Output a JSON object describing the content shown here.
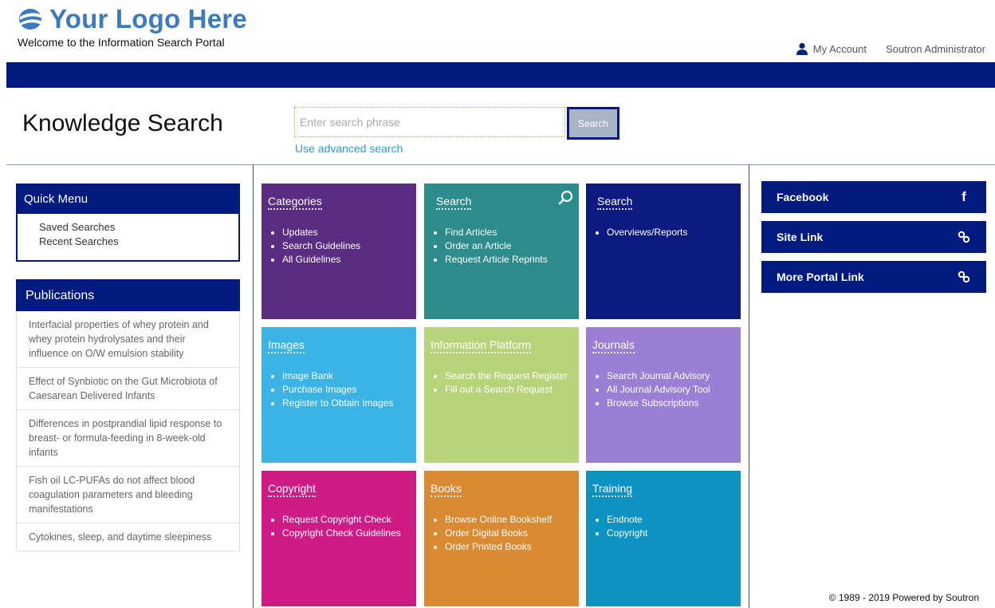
{
  "header": {
    "logo_text": "Your Logo Here",
    "welcome": "Welcome to the Information Search Portal",
    "my_account": "My Account",
    "user_name": "Soutron Administrator",
    "bar_color": "#001a80"
  },
  "search": {
    "title": "Knowledge Search",
    "placeholder": "Enter search phrase",
    "button": "Search",
    "advanced_link": "Use advanced search"
  },
  "quick_menu": {
    "title": "Quick Menu",
    "items": [
      "Saved Searches",
      "Recent Searches"
    ]
  },
  "publications": {
    "title": "Publications",
    "items": [
      "Interfacial properties of whey protein and whey protein hydrolysates and their influence on O/W emulsion stability",
      "Effect of Synbiotic on the Gut Microbiota of Caesarean Delivered Infants",
      "Differences in postprandial lipid response to breast- or formula-feeding in 8-week-old infants",
      "Fish oil LC-PUFAs do not affect blood coagulation parameters and bleeding manifestations",
      "Cytokines, sleep, and daytime sleepiness"
    ]
  },
  "tiles": [
    {
      "title": "Categories",
      "color": "#5a2d82",
      "icon": "",
      "items": [
        "Updates",
        "Search Guidelines",
        "All Guidelines"
      ]
    },
    {
      "title": "Search",
      "color": "#2e8b8b",
      "icon": "search-icon",
      "items": [
        "Find Articles",
        "Order an Article",
        "Request Article Reprints"
      ]
    },
    {
      "title": "Search",
      "color": "#0d1a82",
      "icon": "",
      "items": [
        "Overviews/Reports"
      ]
    },
    {
      "title": "Images",
      "color": "#3bb3e4",
      "icon": "",
      "items": [
        "Image Bank",
        "Purchase Images",
        "Register to Obtain Images"
      ]
    },
    {
      "title": "Information Platform",
      "color": "#b8d47a",
      "icon": "",
      "items": [
        "Search the Request Register",
        "Fill out a Search Request"
      ]
    },
    {
      "title": "Journals",
      "color": "#9b7fd4",
      "icon": "",
      "items": [
        "Search Journal Advisory",
        "All Journal Advisory Tool",
        "Browse Subscriptions"
      ]
    },
    {
      "title": "Copyright",
      "color": "#cf1b86",
      "icon": "",
      "items": [
        "Request Copyright Check",
        "Copyright Check Guidelines"
      ]
    },
    {
      "title": "Books",
      "color": "#d98a33",
      "icon": "",
      "items": [
        "Browse Online Bookshelf",
        "Order Digital Books",
        "Order Printed Books"
      ]
    },
    {
      "title": "Training",
      "color": "#0e92c2",
      "icon": "",
      "items": [
        "Endnote",
        "Copyright"
      ]
    }
  ],
  "links": [
    {
      "label": "Facebook",
      "icon": "facebook-icon"
    },
    {
      "label": "Site Link",
      "icon": "link-icon"
    },
    {
      "label": "More Portal Link",
      "icon": "link-icon"
    }
  ],
  "footer": {
    "copyright": "© 1989 - 2019 Powered by Soutron"
  }
}
